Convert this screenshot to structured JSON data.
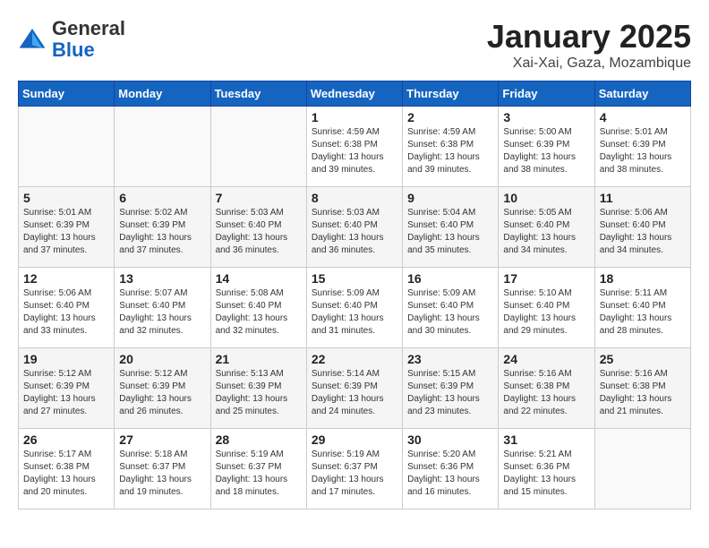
{
  "header": {
    "logo_line1": "General",
    "logo_line2": "Blue",
    "title": "January 2025",
    "subtitle": "Xai-Xai, Gaza, Mozambique"
  },
  "days_of_week": [
    "Sunday",
    "Monday",
    "Tuesday",
    "Wednesday",
    "Thursday",
    "Friday",
    "Saturday"
  ],
  "weeks": [
    [
      {
        "day": "",
        "info": ""
      },
      {
        "day": "",
        "info": ""
      },
      {
        "day": "",
        "info": ""
      },
      {
        "day": "1",
        "info": "Sunrise: 4:59 AM\nSunset: 6:38 PM\nDaylight: 13 hours\nand 39 minutes."
      },
      {
        "day": "2",
        "info": "Sunrise: 4:59 AM\nSunset: 6:38 PM\nDaylight: 13 hours\nand 39 minutes."
      },
      {
        "day": "3",
        "info": "Sunrise: 5:00 AM\nSunset: 6:39 PM\nDaylight: 13 hours\nand 38 minutes."
      },
      {
        "day": "4",
        "info": "Sunrise: 5:01 AM\nSunset: 6:39 PM\nDaylight: 13 hours\nand 38 minutes."
      }
    ],
    [
      {
        "day": "5",
        "info": "Sunrise: 5:01 AM\nSunset: 6:39 PM\nDaylight: 13 hours\nand 37 minutes."
      },
      {
        "day": "6",
        "info": "Sunrise: 5:02 AM\nSunset: 6:39 PM\nDaylight: 13 hours\nand 37 minutes."
      },
      {
        "day": "7",
        "info": "Sunrise: 5:03 AM\nSunset: 6:40 PM\nDaylight: 13 hours\nand 36 minutes."
      },
      {
        "day": "8",
        "info": "Sunrise: 5:03 AM\nSunset: 6:40 PM\nDaylight: 13 hours\nand 36 minutes."
      },
      {
        "day": "9",
        "info": "Sunrise: 5:04 AM\nSunset: 6:40 PM\nDaylight: 13 hours\nand 35 minutes."
      },
      {
        "day": "10",
        "info": "Sunrise: 5:05 AM\nSunset: 6:40 PM\nDaylight: 13 hours\nand 34 minutes."
      },
      {
        "day": "11",
        "info": "Sunrise: 5:06 AM\nSunset: 6:40 PM\nDaylight: 13 hours\nand 34 minutes."
      }
    ],
    [
      {
        "day": "12",
        "info": "Sunrise: 5:06 AM\nSunset: 6:40 PM\nDaylight: 13 hours\nand 33 minutes."
      },
      {
        "day": "13",
        "info": "Sunrise: 5:07 AM\nSunset: 6:40 PM\nDaylight: 13 hours\nand 32 minutes."
      },
      {
        "day": "14",
        "info": "Sunrise: 5:08 AM\nSunset: 6:40 PM\nDaylight: 13 hours\nand 32 minutes."
      },
      {
        "day": "15",
        "info": "Sunrise: 5:09 AM\nSunset: 6:40 PM\nDaylight: 13 hours\nand 31 minutes."
      },
      {
        "day": "16",
        "info": "Sunrise: 5:09 AM\nSunset: 6:40 PM\nDaylight: 13 hours\nand 30 minutes."
      },
      {
        "day": "17",
        "info": "Sunrise: 5:10 AM\nSunset: 6:40 PM\nDaylight: 13 hours\nand 29 minutes."
      },
      {
        "day": "18",
        "info": "Sunrise: 5:11 AM\nSunset: 6:40 PM\nDaylight: 13 hours\nand 28 minutes."
      }
    ],
    [
      {
        "day": "19",
        "info": "Sunrise: 5:12 AM\nSunset: 6:39 PM\nDaylight: 13 hours\nand 27 minutes."
      },
      {
        "day": "20",
        "info": "Sunrise: 5:12 AM\nSunset: 6:39 PM\nDaylight: 13 hours\nand 26 minutes."
      },
      {
        "day": "21",
        "info": "Sunrise: 5:13 AM\nSunset: 6:39 PM\nDaylight: 13 hours\nand 25 minutes."
      },
      {
        "day": "22",
        "info": "Sunrise: 5:14 AM\nSunset: 6:39 PM\nDaylight: 13 hours\nand 24 minutes."
      },
      {
        "day": "23",
        "info": "Sunrise: 5:15 AM\nSunset: 6:39 PM\nDaylight: 13 hours\nand 23 minutes."
      },
      {
        "day": "24",
        "info": "Sunrise: 5:16 AM\nSunset: 6:38 PM\nDaylight: 13 hours\nand 22 minutes."
      },
      {
        "day": "25",
        "info": "Sunrise: 5:16 AM\nSunset: 6:38 PM\nDaylight: 13 hours\nand 21 minutes."
      }
    ],
    [
      {
        "day": "26",
        "info": "Sunrise: 5:17 AM\nSunset: 6:38 PM\nDaylight: 13 hours\nand 20 minutes."
      },
      {
        "day": "27",
        "info": "Sunrise: 5:18 AM\nSunset: 6:37 PM\nDaylight: 13 hours\nand 19 minutes."
      },
      {
        "day": "28",
        "info": "Sunrise: 5:19 AM\nSunset: 6:37 PM\nDaylight: 13 hours\nand 18 minutes."
      },
      {
        "day": "29",
        "info": "Sunrise: 5:19 AM\nSunset: 6:37 PM\nDaylight: 13 hours\nand 17 minutes."
      },
      {
        "day": "30",
        "info": "Sunrise: 5:20 AM\nSunset: 6:36 PM\nDaylight: 13 hours\nand 16 minutes."
      },
      {
        "day": "31",
        "info": "Sunrise: 5:21 AM\nSunset: 6:36 PM\nDaylight: 13 hours\nand 15 minutes."
      },
      {
        "day": "",
        "info": ""
      }
    ]
  ]
}
